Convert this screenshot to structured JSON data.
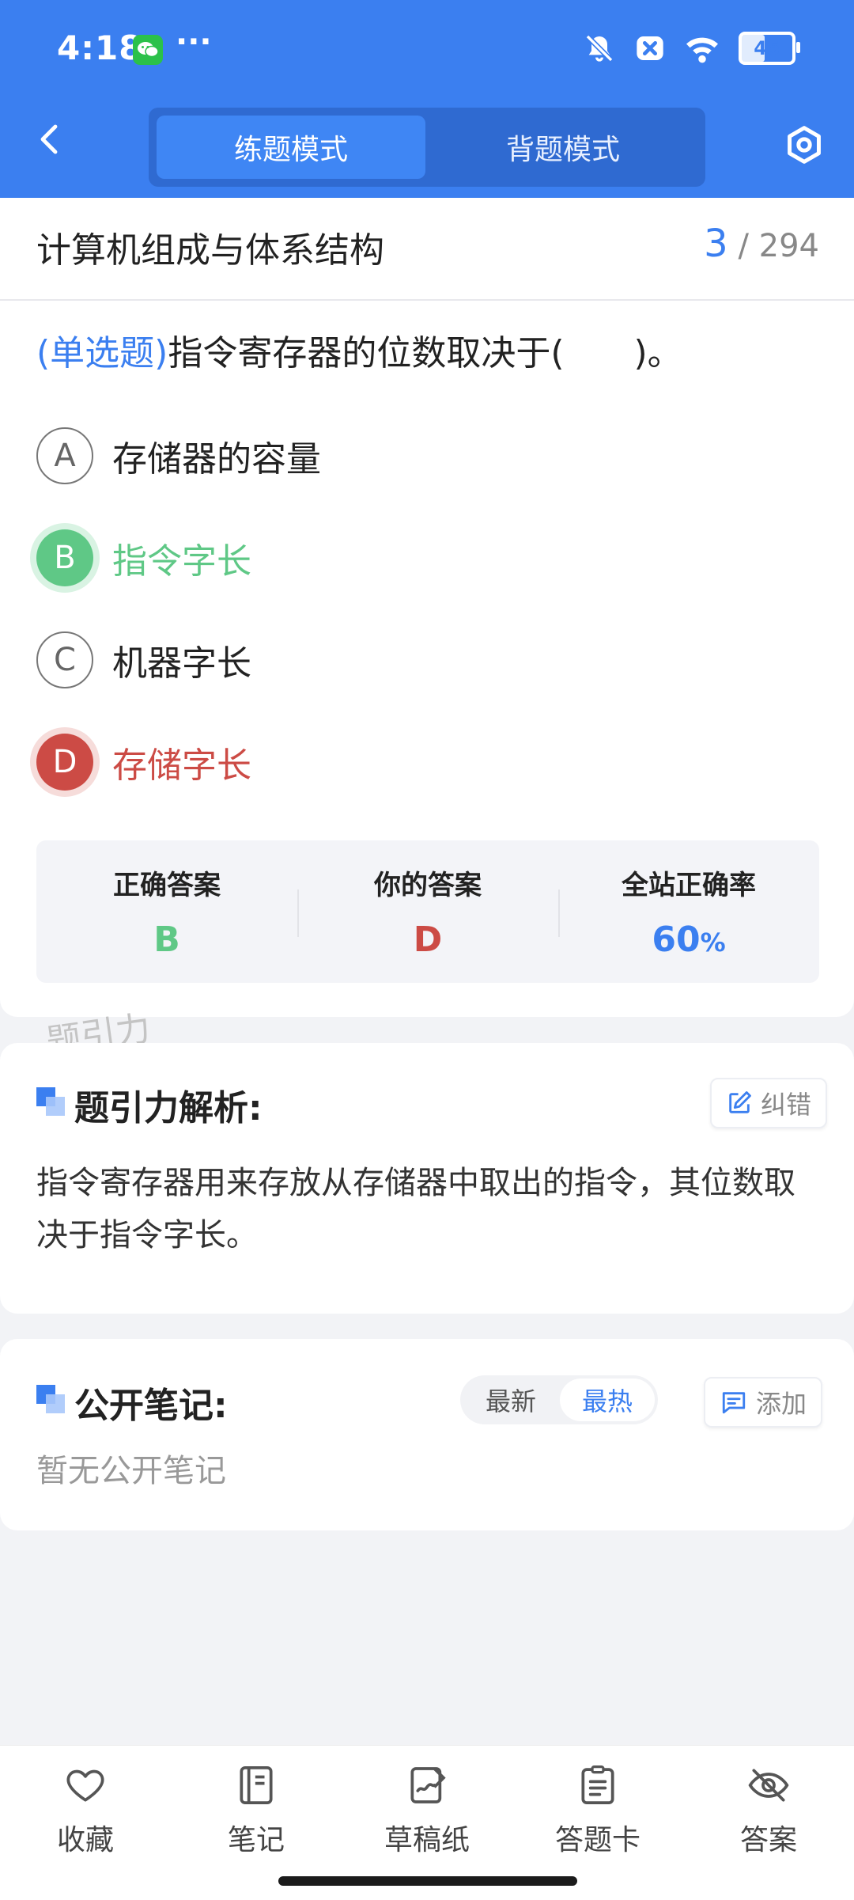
{
  "status_bar": {
    "time": "4:18",
    "overflow": "···",
    "battery": "45"
  },
  "header": {
    "modes": [
      {
        "label": "练题模式",
        "active": true
      },
      {
        "label": "背题模式",
        "active": false
      }
    ]
  },
  "subject": "计算机组成与体系结构",
  "progress": {
    "current": "3",
    "sep": "/",
    "total": "294"
  },
  "question": {
    "type": "(单选题)",
    "text": "指令寄存器的位数取决于(　　)。"
  },
  "options": [
    {
      "key": "A",
      "text": "存储器的容量",
      "state": "normal"
    },
    {
      "key": "B",
      "text": "指令字长",
      "state": "correct"
    },
    {
      "key": "C",
      "text": "机器字长",
      "state": "normal"
    },
    {
      "key": "D",
      "text": "存储字长",
      "state": "wrong"
    }
  ],
  "result": {
    "correct_label": "正确答案",
    "correct_value": "B",
    "yours_label": "你的答案",
    "yours_value": "D",
    "rate_label": "全站正确率",
    "rate_value": "60",
    "rate_unit": "%"
  },
  "watermark": "题引力",
  "analysis": {
    "title": "题引力解析:",
    "report_label": "纠错",
    "text": "指令寄存器用来存放从存储器中取出的指令，其位数取决于指令字长。"
  },
  "notes": {
    "title": "公开笔记:",
    "sort_latest": "最新",
    "sort_hot": "最热",
    "add_label": "添加",
    "empty_text": "暂无公开笔记"
  },
  "bottom_nav": [
    {
      "label": "收藏",
      "icon": "heart-icon"
    },
    {
      "label": "笔记",
      "icon": "notebook-icon"
    },
    {
      "label": "草稿纸",
      "icon": "draft-icon"
    },
    {
      "label": "答题卡",
      "icon": "answer-sheet-icon"
    },
    {
      "label": "答案",
      "icon": "eye-off-icon"
    }
  ],
  "colors": {
    "primary": "#3b7ff0",
    "correct": "#5fc886",
    "wrong": "#cc4b45"
  }
}
